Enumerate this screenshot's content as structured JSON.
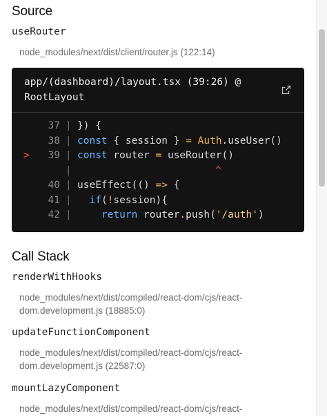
{
  "source": {
    "title": "Source",
    "function": "useRouter",
    "location": "node_modules/next/dist/client/router.js (122:14)"
  },
  "code_frame": {
    "file": "app/(dashboard)/layout.tsx (39:26) @",
    "symbol": "RootLayout",
    "open_icon": "external-link-icon",
    "lines": [
      {
        "marker": "",
        "number": "37",
        "code": [
          {
            "t": "}) {",
            "c": "f"
          }
        ]
      },
      {
        "marker": "",
        "number": "38",
        "code": [
          {
            "t": "const",
            "c": "k"
          },
          {
            "t": " { session } ",
            "c": "f"
          },
          {
            "t": "=",
            "c": "o"
          },
          {
            "t": " ",
            "c": "f"
          },
          {
            "t": "Auth",
            "c": "o"
          },
          {
            "t": ".useUser()",
            "c": "f"
          }
        ]
      },
      {
        "marker": ">",
        "number": "39",
        "code": [
          {
            "t": "const",
            "c": "k"
          },
          {
            "t": " router ",
            "c": "f"
          },
          {
            "t": "=",
            "c": "o"
          },
          {
            "t": " useRouter()",
            "c": "f"
          }
        ]
      },
      {
        "marker": "",
        "number": "",
        "caret": "^",
        "code": []
      },
      {
        "marker": "",
        "number": "40",
        "code": [
          {
            "t": "useEffect(() ",
            "c": "f"
          },
          {
            "t": "=>",
            "c": "o"
          },
          {
            "t": " {",
            "c": "f"
          }
        ]
      },
      {
        "marker": "",
        "number": "41",
        "code": [
          {
            "t": "  ",
            "c": "f"
          },
          {
            "t": "if",
            "c": "k"
          },
          {
            "t": "(",
            "c": "f"
          },
          {
            "t": "!",
            "c": "o"
          },
          {
            "t": "session){",
            "c": "f"
          }
        ]
      },
      {
        "marker": "",
        "number": "42",
        "code": [
          {
            "t": "    ",
            "c": "f"
          },
          {
            "t": "return",
            "c": "k"
          },
          {
            "t": " router",
            "c": "f"
          },
          {
            "t": ".",
            "c": "o"
          },
          {
            "t": "push(",
            "c": "f"
          },
          {
            "t": "'/auth'",
            "c": "s"
          },
          {
            "t": ")",
            "c": "f"
          }
        ]
      }
    ]
  },
  "call_stack": {
    "title": "Call Stack",
    "frames": [
      {
        "function": "renderWithHooks",
        "location_line1": "node_modules/next/dist/compiled/react-dom/cjs/react-",
        "location_line2": "dom.development.js (18885:0)"
      },
      {
        "function": "updateFunctionComponent",
        "location_line1": "node_modules/next/dist/compiled/react-dom/cjs/react-",
        "location_line2": "dom.development.js (22587:0)"
      },
      {
        "function": "mountLazyComponent",
        "location_line1": "node_modules/next/dist/compiled/react-dom/cjs/react-",
        "location_line2": ""
      }
    ]
  }
}
